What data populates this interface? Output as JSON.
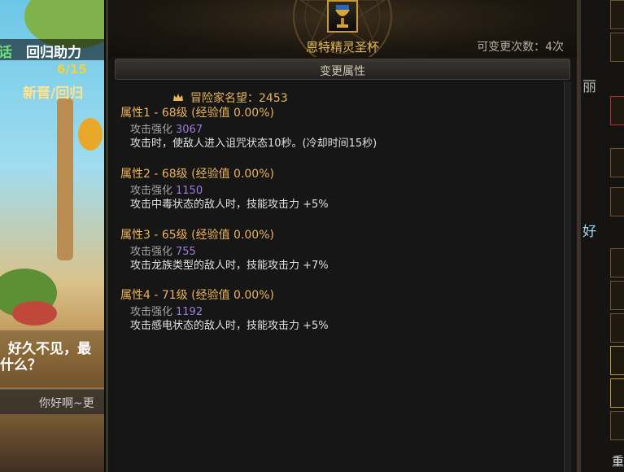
{
  "background": {
    "title_text": "回归助力",
    "side_label": "话",
    "counter_text": "6/15",
    "subtitle_text": "新晋/回归",
    "chat_message_1": "好久不见，最",
    "chat_message_2": "什么？",
    "chat_input_text": "你好啊~更",
    "right_side_text_1": "丽",
    "right_side_text_2": "好",
    "right_side_text_3": "重"
  },
  "item": {
    "name": "恩特精灵圣杯",
    "change_count_text": "可变更次数：4次",
    "icon": "chalice-icon"
  },
  "tab": {
    "label": "变更属性"
  },
  "adventurer": {
    "label": "冒险家名望：2453",
    "icon": "crown-icon"
  },
  "attributes": [
    {
      "title": "属性1 - 68级 (经验值 0.00%)",
      "sub_label": "攻击强化",
      "sub_value": "3067",
      "desc": "攻击时，使敌人进入诅咒状态10秒。(冷却时间15秒)"
    },
    {
      "title": "属性2 - 68级 (经验值 0.00%)",
      "sub_label": "攻击强化",
      "sub_value": "1150",
      "desc": "攻击中毒状态的敌人时，技能攻击力 +5%"
    },
    {
      "title": "属性3 - 65级 (经验值 0.00%)",
      "sub_label": "攻击强化",
      "sub_value": "755",
      "desc": "攻击龙族类型的敌人时，技能攻击力 +7%"
    },
    {
      "title": "属性4 - 71级 (经验值 0.00%)",
      "sub_label": "攻击强化",
      "sub_value": "1192",
      "desc": "攻击感电状态的敌人时，技能攻击力 +5%"
    }
  ],
  "colors": {
    "gold": "#e9b35d",
    "purple_value": "#a07bdf",
    "panel_bg": "#161616"
  }
}
